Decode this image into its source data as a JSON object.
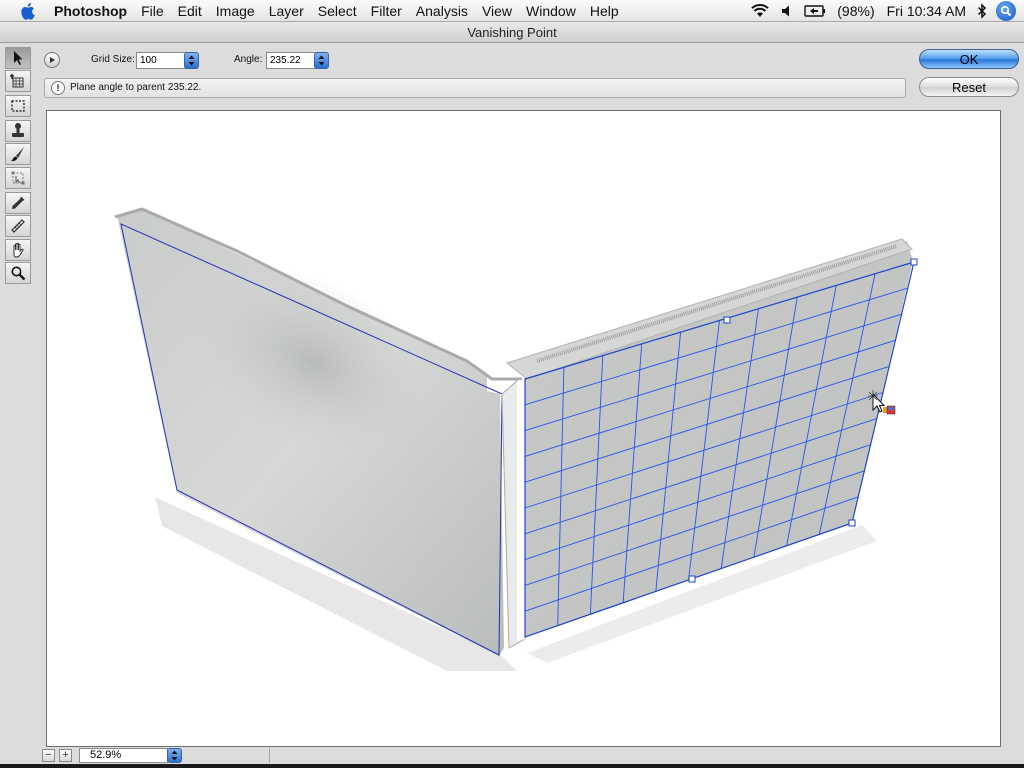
{
  "menubar": {
    "app_name": "Photoshop",
    "menus": [
      "File",
      "Edit",
      "Image",
      "Layer",
      "Select",
      "Filter",
      "Analysis",
      "View",
      "Window",
      "Help"
    ],
    "battery": "(98%)",
    "clock": "Fri 10:34 AM",
    "icons": [
      "apple-icon",
      "wifi-icon",
      "volume-icon",
      "battery-icon",
      "bluetooth-icon",
      "spotlight-icon"
    ]
  },
  "window": {
    "title": "Vanishing Point"
  },
  "options": {
    "grid_size_label": "Grid Size:",
    "grid_size_value": "100",
    "angle_label": "Angle:",
    "angle_value": "235.22"
  },
  "message": {
    "text": "Plane angle to parent 235.22."
  },
  "buttons": {
    "ok": "OK",
    "reset": "Reset"
  },
  "tools": [
    "edit-plane-tool",
    "create-plane-tool",
    "marquee-tool",
    "stamp-tool",
    "brush-tool",
    "transform-tool",
    "eyedropper-tool",
    "measure-tool",
    "hand-tool",
    "zoom-tool"
  ],
  "status": {
    "zoom": "52.9%"
  },
  "colors": {
    "grid_line": "#2255ee",
    "ok_button": "#2b78d8",
    "canvas": "#ffffff"
  }
}
